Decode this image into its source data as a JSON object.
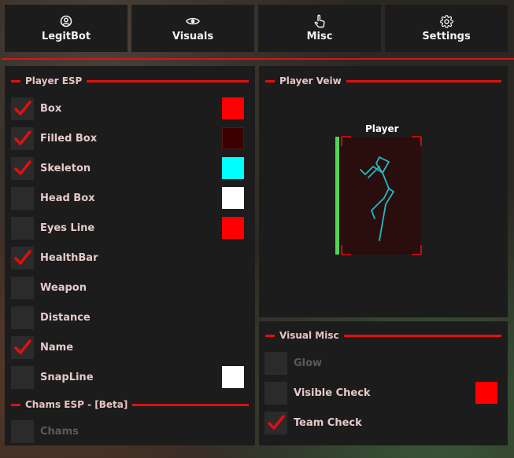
{
  "tabs": [
    {
      "id": "legitbot",
      "label": "LegitBot",
      "icon": "user-circle-icon"
    },
    {
      "id": "visuals",
      "label": "Visuals",
      "icon": "eye-icon"
    },
    {
      "id": "misc",
      "label": "Misc",
      "icon": "hand-pointer-icon"
    },
    {
      "id": "settings",
      "label": "Settings",
      "icon": "gear-icon"
    }
  ],
  "player_esp": {
    "title": "Player ESP",
    "items": [
      {
        "label": "Box",
        "checked": true,
        "color": "#ff0000"
      },
      {
        "label": "Filled Box",
        "checked": true,
        "color": "#3a0000"
      },
      {
        "label": "Skeleton",
        "checked": true,
        "color": "#00ffff"
      },
      {
        "label": "Head Box",
        "checked": false,
        "color": "#ffffff"
      },
      {
        "label": "Eyes Line",
        "checked": false,
        "color": "#ff0000"
      },
      {
        "label": "HealthBar",
        "checked": true
      },
      {
        "label": "Weapon",
        "checked": false
      },
      {
        "label": "Distance",
        "checked": false
      },
      {
        "label": "Name",
        "checked": true
      },
      {
        "label": "SnapLine",
        "checked": false,
        "color": "#ffffff"
      }
    ]
  },
  "chams_esp": {
    "title": "Chams ESP - [Beta]",
    "items": [
      {
        "label": "Chams",
        "checked": false,
        "disabled": true
      }
    ]
  },
  "player_view": {
    "title": "Player Veiw",
    "player_label": "Player",
    "health_color": "#54d354",
    "box_color": "#e01010",
    "skeleton_color": "#1fbcc4"
  },
  "visual_misc": {
    "title": "Visual Misc",
    "items": [
      {
        "label": "Glow",
        "checked": false,
        "disabled": true
      },
      {
        "label": "Visible Check",
        "checked": false,
        "color": "#ff0000"
      },
      {
        "label": "Team Check",
        "checked": true
      }
    ]
  },
  "colors": {
    "accent": "#e01010",
    "panel": "#1c1c1c",
    "check": "#e01010"
  }
}
